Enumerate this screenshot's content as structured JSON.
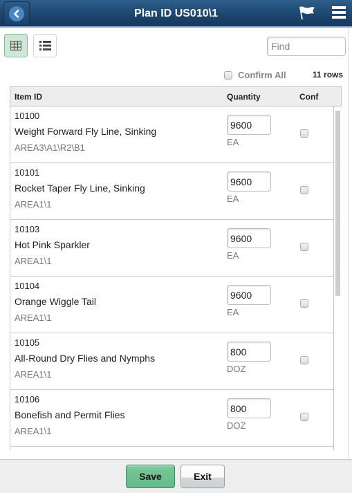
{
  "header": {
    "title": "Plan ID US010\\1",
    "back_icon": "chevron-left-circle-icon",
    "flag_icon": "flag-icon",
    "menu_icon": "hamburger-menu-icon"
  },
  "toolbar": {
    "grid_view_icon": "grid-view-icon",
    "list_view_icon": "list-view-icon",
    "grid_view_active": true,
    "find_placeholder": "Find",
    "find_value": "",
    "confirm_all_label": "Confirm All",
    "confirm_all_checked": false,
    "rows_count": "11 rows"
  },
  "table": {
    "columns": [
      "Item ID",
      "Quantity",
      "Conf"
    ],
    "rows": [
      {
        "item_id": "10100",
        "description": "Weight Forward Fly Line, Sinking",
        "location": "AREA3\\A1\\R2\\B1",
        "quantity": "9600",
        "uom": "EA",
        "confirmed": false
      },
      {
        "item_id": "10101",
        "description": "Rocket Taper Fly Line, Sinking",
        "location": "AREA1\\1",
        "quantity": "9600",
        "uom": "EA",
        "confirmed": false
      },
      {
        "item_id": "10103",
        "description": "Hot Pink Sparkler",
        "location": "AREA1\\1",
        "quantity": "9600",
        "uom": "EA",
        "confirmed": false
      },
      {
        "item_id": "10104",
        "description": "Orange Wiggle Tail",
        "location": "AREA1\\1",
        "quantity": "9600",
        "uom": "EA",
        "confirmed": false
      },
      {
        "item_id": "10105",
        "description": "All-Round Dry Flies and Nymphs",
        "location": "AREA1\\1",
        "quantity": "800",
        "uom": "DOZ",
        "confirmed": false
      },
      {
        "item_id": "10106",
        "description": "Bonefish and Permit Flies",
        "location": "AREA1\\1",
        "quantity": "800",
        "uom": "DOZ",
        "confirmed": false
      }
    ]
  },
  "footer": {
    "save_label": "Save",
    "exit_label": "Exit"
  }
}
